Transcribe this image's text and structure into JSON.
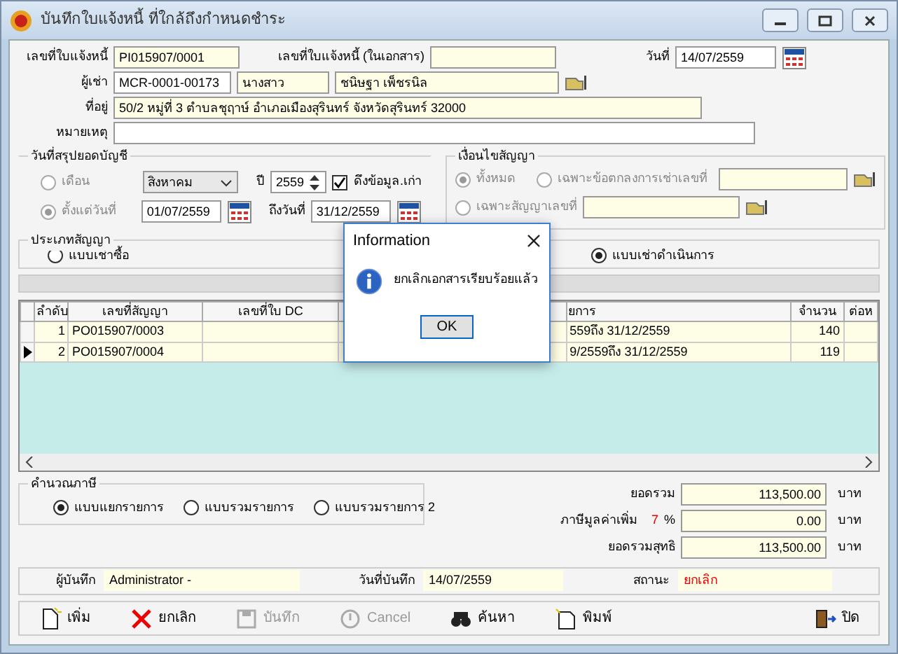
{
  "window": {
    "title": "บันทึกใบแจ้งหนี้ ที่ใกล้ถึงกำหนดชำระ"
  },
  "header": {
    "invoice_no_label": "เลขที่ใบแจ้งหนี้",
    "invoice_no": "PI015907/0001",
    "doc_invoice_label": "เลขที่ใบแจ้งหนี้ (ในเอกสาร)",
    "date_label": "วันที่",
    "date": "14/07/2559",
    "tenant_label": "ผู้เช่า",
    "tenant_code": "MCR-0001-00173",
    "tenant_title": "นางสาว",
    "tenant_name": "ชนิษฐา เพ็ชรนิล",
    "address_label": "ที่อยู่",
    "address": "50/2 หมู่ที่ 3 ตำบลชุฤาษ์ อำเภอเมืองสุรินทร์ จังหวัดสุรินทร์ 32000",
    "note_label": "หมายเหตุ"
  },
  "period": {
    "title": "วันที่สรุปยอดบัญชี",
    "month_option": {
      "label": "เดือน",
      "selected": false
    },
    "month": "สิงหาคม",
    "year_label": "ปี",
    "year": "2559",
    "old_data": {
      "label": "ดึงข้อมูล.เก่า",
      "checked": true
    },
    "from_option": {
      "label": "ตั้งแต่วันที่",
      "selected": true
    },
    "from": "01/07/2559",
    "to_label": "ถึงวันที่",
    "to": "31/12/2559"
  },
  "condition": {
    "title": "เงื่อนไขสัญญา",
    "options": [
      {
        "label": "ทั้งหมด",
        "selected": true
      },
      {
        "label": "เฉพาะข้อตกลงการเช่าเลขที่",
        "selected": false
      },
      {
        "label": "เฉพาะสัญญาเลขที่",
        "selected": false
      }
    ]
  },
  "contract_type": {
    "title": "ประเภทสัญญา",
    "options": [
      {
        "label": "แบบเช่าซื้อ",
        "selected": false
      },
      {
        "label": "แบบเช่าดำเนินการ",
        "selected": true
      }
    ]
  },
  "table": {
    "columns": [
      "ลำดับ",
      "เลขที่สัญญา",
      "เลขที่ใบ DC",
      "",
      "ยการ",
      "จำนวน",
      "ต่อห"
    ],
    "rows": [
      {
        "current": false,
        "cells": [
          "1",
          "PO015907/0003",
          "",
          "",
          "559ถึง 31/12/2559",
          "140",
          ""
        ]
      },
      {
        "current": true,
        "cells": [
          "2",
          "PO015907/0004",
          "",
          "",
          "9/2559ถึง 31/12/2559",
          "119",
          ""
        ]
      }
    ]
  },
  "tax": {
    "title": "คำนวณภาษี",
    "options": [
      {
        "label": "แบบแยกรายการ",
        "selected": true
      },
      {
        "label": "แบบรวมรายการ",
        "selected": false
      },
      {
        "label": "แบบรวมรายการ 2",
        "selected": false
      }
    ]
  },
  "totals": [
    {
      "label": "ยอดรวม",
      "value": "113,500.00",
      "unit": "บาท"
    },
    {
      "label": "ภาษีมูลค่าเพิ่ม",
      "rate": "7",
      "percent": "%",
      "value": "0.00",
      "unit": "บาท"
    },
    {
      "label": "ยอดรวมสุทธิ",
      "value": "113,500.00",
      "unit": "บาท"
    }
  ],
  "status_bar": {
    "recorder_label": "ผู้บันทึก",
    "recorder": "Administrator -",
    "record_date_label": "วันที่บันทึก",
    "record_date": "14/07/2559",
    "status_label": "สถานะ",
    "status": "ยกเลิก"
  },
  "toolbar": [
    {
      "kind": "new",
      "label": "เพิ่ม",
      "disabled": false
    },
    {
      "kind": "void",
      "label": "ยกเลิก",
      "disabled": false
    },
    {
      "kind": "save",
      "label": "บันทึก",
      "disabled": true
    },
    {
      "kind": "cancel",
      "label": "Cancel",
      "disabled": true
    },
    {
      "kind": "find",
      "label": "ค้นหา",
      "disabled": false
    },
    {
      "kind": "print",
      "label": "พิมพ์",
      "disabled": false
    },
    {
      "kind": "close",
      "label": "ปิด",
      "disabled": false
    }
  ],
  "dialog": {
    "title": "Information",
    "message": "ยกเลิกเอกสารเรียบร้อยแล้ว",
    "button": "OK"
  }
}
